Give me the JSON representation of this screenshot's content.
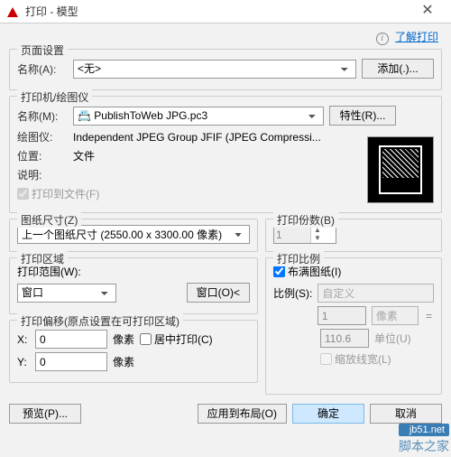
{
  "window": {
    "title": "打印 - 模型",
    "closeGlyph": "✕"
  },
  "learn": {
    "text": "了解打印"
  },
  "pageSetup": {
    "legend": "页面设置",
    "nameLabel": "名称(A):",
    "nameValue": "<无>",
    "addBtn": "添加(.)..."
  },
  "printer": {
    "legend": "打印机/绘图仪",
    "nameLabel": "名称(M):",
    "nameValue": "📇 PublishToWeb JPG.pc3",
    "propsBtn": "特性(R)...",
    "plotterLabel": "绘图仪:",
    "plotterValue": "Independent JPEG Group JFIF (JPEG Compressi...",
    "locationLabel": "位置:",
    "locationValue": "文件",
    "descLabel": "说明:",
    "toFile": "打印到文件(F)"
  },
  "paper": {
    "legend": "图纸尺寸(Z)",
    "value": "上一个图纸尺寸 (2550.00 x 3300.00 像素)"
  },
  "copies": {
    "legend": "打印份数(B)",
    "value": "1"
  },
  "area": {
    "legend": "打印区域",
    "rangeLabel": "打印范围(W):",
    "rangeValue": "窗口",
    "windowBtn": "窗口(O)<"
  },
  "offset": {
    "legend": "打印偏移(原点设置在可打印区域)",
    "xLabel": "X:",
    "xValue": "0",
    "yLabel": "Y:",
    "yValue": "0",
    "unit": "像素",
    "center": "居中打印(C)"
  },
  "scale": {
    "legend": "打印比例",
    "fit": "布满图纸(I)",
    "ratioLabel": "比例(S):",
    "ratioValue": "自定义",
    "val1": "1",
    "unit1": "像素",
    "val2": "110.6",
    "unit2": "单位(U)",
    "lineweight": "缩放线宽(L)"
  },
  "buttons": {
    "preview": "预览(P)...",
    "apply": "应用到布局(O)",
    "ok": "确定",
    "cancel": "取消"
  },
  "watermark": {
    "url": "jb51.net",
    "brand": "脚本之家"
  }
}
